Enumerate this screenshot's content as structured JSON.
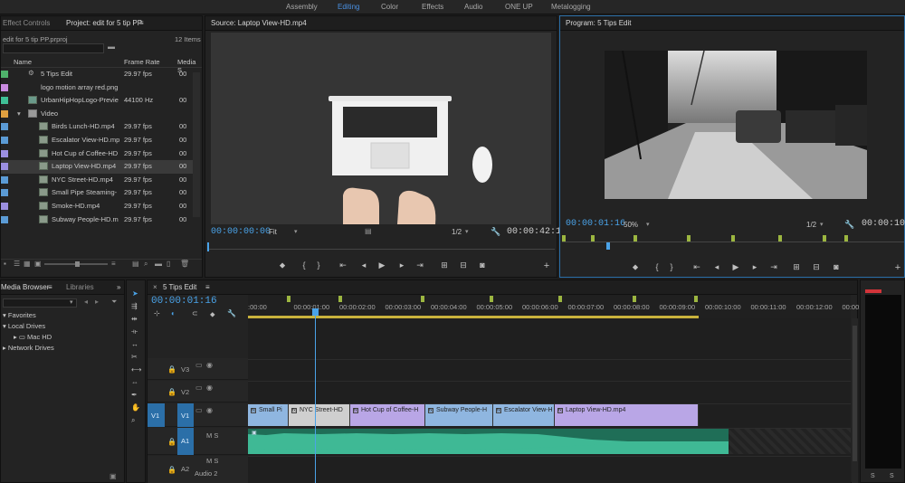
{
  "workspaces": [
    {
      "label": "Assembly",
      "active": false
    },
    {
      "label": "Editing",
      "active": true
    },
    {
      "label": "Color",
      "active": false
    },
    {
      "label": "Effects",
      "active": false
    },
    {
      "label": "Audio",
      "active": false
    },
    {
      "label": "ONE UP",
      "active": false
    },
    {
      "label": "Metalogging",
      "active": false
    }
  ],
  "project_panel": {
    "tabs": [
      "Effect Controls",
      "Project: edit for 5 tip PP"
    ],
    "filename": "edit for 5 tip PP.prproj",
    "item_count": "12 Items",
    "columns": [
      "Name",
      "Frame Rate",
      "Media S"
    ],
    "items": [
      {
        "name": "5 Tips Edit",
        "rate": "29.97 fps",
        "media": "00",
        "color": "#4fb36b",
        "indent": 0,
        "icon": "sequence"
      },
      {
        "name": "logo motion array red.png",
        "rate": "",
        "media": "",
        "color": "#c98be0",
        "indent": 0,
        "icon": "image"
      },
      {
        "name": "UrbanHipHopLogo-Previe",
        "rate": "44100 Hz",
        "media": "00",
        "color": "#3fbf96",
        "indent": 0,
        "icon": "audio"
      },
      {
        "name": "Video",
        "rate": "",
        "media": "",
        "color": "#e0a040",
        "indent": 0,
        "icon": "folder"
      },
      {
        "name": "Birds Lunch-HD.mp4",
        "rate": "29.97 fps",
        "media": "00",
        "color": "#5b9bd5",
        "indent": 1,
        "icon": "clip"
      },
      {
        "name": "Escalator View-HD.mp",
        "rate": "29.97 fps",
        "media": "00",
        "color": "#5b9bd5",
        "indent": 1,
        "icon": "clip"
      },
      {
        "name": "Hot Cup of Coffee-HD",
        "rate": "29.97 fps",
        "media": "00",
        "color": "#9b8fe0",
        "indent": 1,
        "icon": "clip"
      },
      {
        "name": "Laptop View-HD.mp4",
        "rate": "29.97 fps",
        "media": "00",
        "color": "#9b8fe0",
        "indent": 1,
        "icon": "clip",
        "selected": true
      },
      {
        "name": "NYC Street-HD.mp4",
        "rate": "29.97 fps",
        "media": "00",
        "color": "#5b9bd5",
        "indent": 1,
        "icon": "clip"
      },
      {
        "name": "Small Pipe Steaming-",
        "rate": "29.97 fps",
        "media": "00",
        "color": "#5b9bd5",
        "indent": 1,
        "icon": "clip"
      },
      {
        "name": "Smoke-HD.mp4",
        "rate": "29.97 fps",
        "media": "00",
        "color": "#9b8fe0",
        "indent": 1,
        "icon": "clip"
      },
      {
        "name": "Subway People-HD.m",
        "rate": "29.97 fps",
        "media": "00",
        "color": "#5b9bd5",
        "indent": 1,
        "icon": "clip"
      }
    ]
  },
  "source_monitor": {
    "title": "Source: Laptop View-HD.mp4",
    "timecode": "00:00:00:00",
    "fit": "Fit",
    "resolution": "1/2",
    "duration": "00:00:42:14"
  },
  "program_monitor": {
    "title": "Program: 5 Tips Edit",
    "timecode": "00:00:01:16",
    "zoom": "50%",
    "resolution": "1/2",
    "duration": "00:00:10:29"
  },
  "media_browser": {
    "tabs": [
      "Media Browser",
      "Libraries"
    ],
    "tree": [
      {
        "label": "Favorites",
        "indent": 0
      },
      {
        "label": "Local Drives",
        "indent": 0
      },
      {
        "label": "Mac HD",
        "indent": 1
      },
      {
        "label": "Network Drives",
        "indent": 0
      }
    ]
  },
  "timeline": {
    "tab": "5 Tips Edit",
    "timecode": "00:00:01:16",
    "ruler": [
      ":00:00",
      "00:00:01:00",
      "00:00:02:00",
      "00:00:03:00",
      "00:00:04:00",
      "00:00:05:00",
      "00:00:06:00",
      "00:00:07:00",
      "00:00:08:00",
      "00:00:09:00",
      "00:00:10:00",
      "00:00:11:00",
      "00:00:12:00",
      "00:00:13:00"
    ],
    "tracks": [
      {
        "name": "V3",
        "type": "video"
      },
      {
        "name": "V2",
        "type": "video"
      },
      {
        "name": "V1",
        "type": "video",
        "source": "V1"
      },
      {
        "name": "A1",
        "type": "audio",
        "tools": "M S"
      },
      {
        "name": "A2",
        "type": "audio",
        "tools": "M S",
        "label": "Audio 2"
      }
    ],
    "clips": [
      {
        "label": "Small Pi",
        "color": "#8fb6e0"
      },
      {
        "label": "NYC Street-HD",
        "color": "#cfcfcf"
      },
      {
        "label": "Hot Cup of Coffee-H",
        "color": "#b9a6e6"
      },
      {
        "label": "Subway People-H",
        "color": "#8fb6e0"
      },
      {
        "label": "Escalator View-H",
        "color": "#8fb6e0"
      },
      {
        "label": "Laptop View-HD.mp4",
        "color": "#b9a6e6"
      }
    ]
  },
  "meter": {
    "labels": [
      "S",
      "S"
    ]
  }
}
